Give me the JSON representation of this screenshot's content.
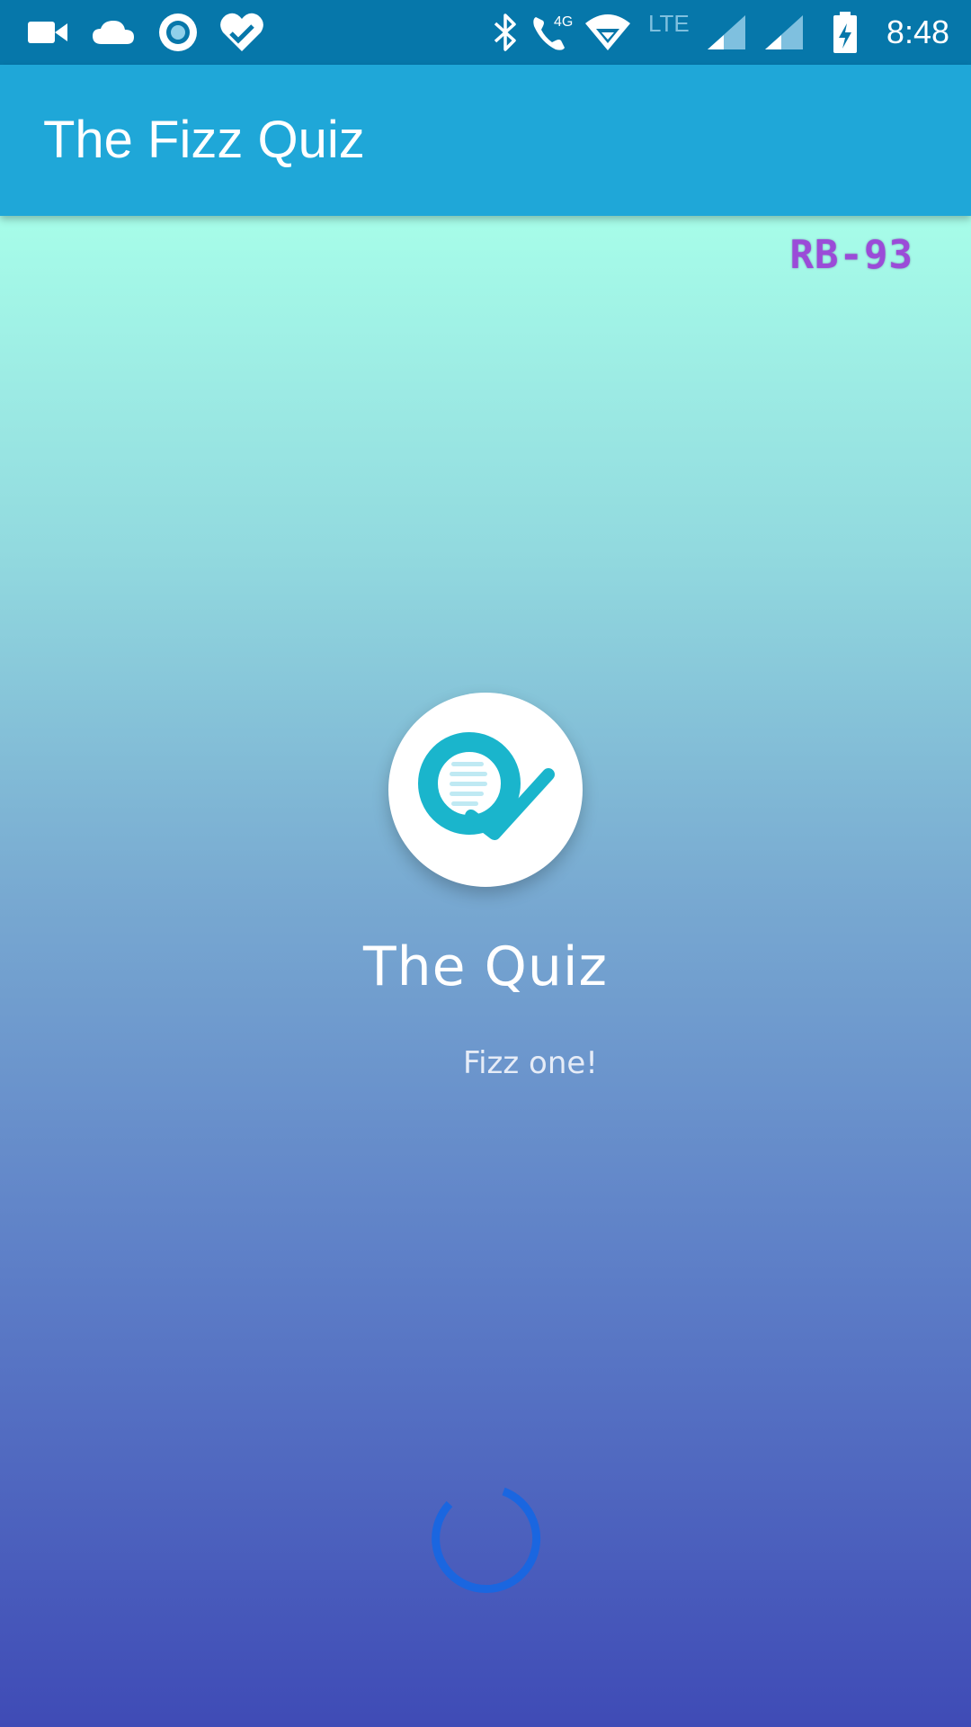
{
  "status_bar": {
    "time": "8:48",
    "icons": [
      "video-camera-icon",
      "cloud-icon",
      "circle-record-icon",
      "heart-check-icon",
      "bluetooth-icon",
      "call-4g-icon",
      "wifi-icon",
      "lte-label-icon",
      "signal-icon",
      "signal-icon",
      "battery-charging-icon"
    ],
    "network_label": "4G",
    "lte_label": "LTE",
    "color": "#0677aa"
  },
  "app_bar": {
    "title": "The Fizz Quiz",
    "color": "#1fa7d8"
  },
  "splash": {
    "badge": "RB-93",
    "logo_icon": "quiz-q-check-icon",
    "title": "The Quiz",
    "subtitle": "Fizz one!",
    "loading_indicator": "progress-spinner-icon",
    "accent_color": "#1ab5cc",
    "spinner_color": "#1a66e0"
  }
}
